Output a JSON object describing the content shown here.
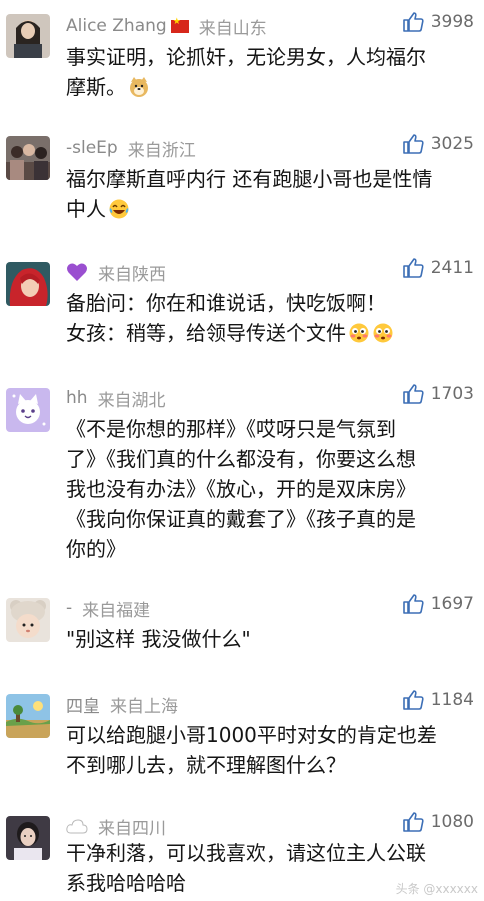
{
  "comments": [
    {
      "name": "Alice Zhang",
      "location": "来自山东",
      "likes": "3998",
      "lines": [
        "事实证明，论抓奸，无论男女，人均福尔",
        "摩斯。"
      ],
      "avatar": "avatar-woman-photo",
      "name_icon": "china-flag-icon"
    },
    {
      "name": "-sleEp",
      "location": "来自浙江",
      "likes": "3025",
      "lines": [
        "福尔摩斯直呼内行 还有跑腿小哥也是性情",
        "中人"
      ],
      "avatar": "avatar-group-photo"
    },
    {
      "name": "",
      "location": "来自陕西",
      "likes": "2411",
      "lines": [
        "备胎问：你在和谁说话，快吃饭啊！",
        "女孩：稍等，给领导传送个文件"
      ],
      "avatar": "avatar-red-hair-mermaid",
      "name_icon": "purple-heart-icon"
    },
    {
      "name": "hh",
      "location": "来自湖北",
      "likes": "1703",
      "lines": [
        "《不是你想的那样》《哎呀只是气氛到",
        "了》《我们真的什么都没有，你要这么想",
        "我也没有办法》《放心，开的是双床房》",
        "《我向你保证真的戴套了》《孩子真的是",
        "你的》"
      ],
      "avatar": "avatar-cartoon-cat"
    },
    {
      "name": "-",
      "location": "来自福建",
      "likes": "1697",
      "lines": [
        "\"别这样 我没做什么\""
      ],
      "avatar": "avatar-baby-bear-hat"
    },
    {
      "name": "四皇",
      "location": "来自上海",
      "likes": "1184",
      "lines": [
        "可以给跑腿小哥1000平时对女的肯定也差",
        "不到哪儿去，就不理解图什么？"
      ],
      "avatar": "avatar-landscape"
    },
    {
      "name": "",
      "location": "来自四川",
      "likes": "1080",
      "lines": [
        "干净利落，可以我喜欢，请这位主人公联",
        "系我哈哈哈哈"
      ],
      "avatar": "avatar-girl-photo",
      "name_icon": "cloud-icon"
    }
  ],
  "watermark": "头条 @xxxxxx"
}
